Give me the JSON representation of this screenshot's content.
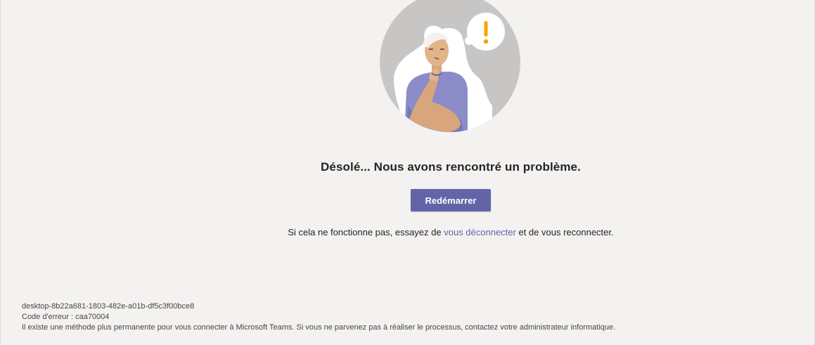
{
  "error": {
    "headline": "Désolé... Nous avons rencontré un problème.",
    "restart_label": "Redémarrer",
    "hint_before": "Si cela ne fonctionne pas, essayez de ",
    "hint_link": "vous déconnecter",
    "hint_after": " et de vous reconnecter."
  },
  "footer": {
    "session_id": "desktop-8b22a681-1803-482e-a01b-df5c3f00bce8",
    "error_code": "Code d'erreur : caa70004",
    "info": "Il existe une méthode plus permanente pour vous connecter à Microsoft Teams. Si vous ne parvenez pas à réaliser le processus, contactez votre administrateur informatique."
  },
  "illustration": {
    "icon": "confused-person-illustration",
    "alert_icon": "exclamation-icon"
  },
  "colors": {
    "background": "#f3f2f1",
    "accent": "#6264a7",
    "text": "#252423",
    "alert": "#f8a300"
  }
}
